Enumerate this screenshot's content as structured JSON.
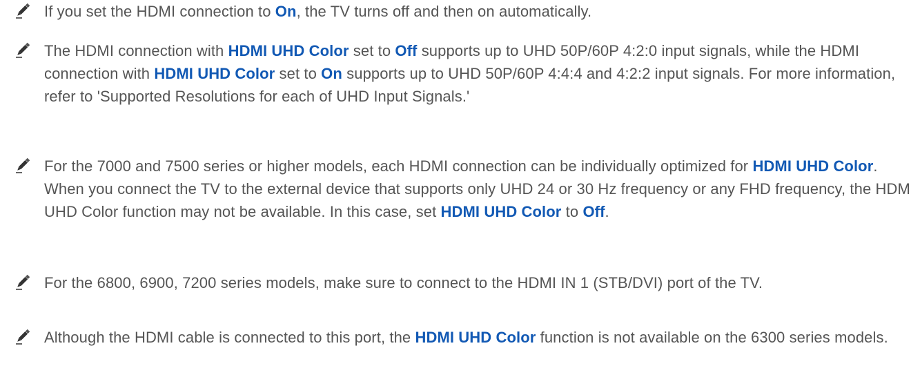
{
  "notes": [
    {
      "segments": [
        {
          "text": "If you set the HDMI connection to ",
          "highlight": false
        },
        {
          "text": "On",
          "highlight": true
        },
        {
          "text": ", the TV turns off and then on automatically.",
          "highlight": false
        }
      ]
    },
    {
      "segments": [
        {
          "text": "The HDMI connection with ",
          "highlight": false
        },
        {
          "text": "HDMI UHD Color",
          "highlight": true
        },
        {
          "text": " set to ",
          "highlight": false
        },
        {
          "text": "Off",
          "highlight": true
        },
        {
          "text": " supports up to UHD 50P/60P 4:2:0 input signals, while the HDMI connection with ",
          "highlight": false
        },
        {
          "text": "HDMI UHD Color",
          "highlight": true
        },
        {
          "text": " set to ",
          "highlight": false
        },
        {
          "text": "On",
          "highlight": true
        },
        {
          "text": " supports up to UHD 50P/60P 4:4:4 and 4:2:2 input signals. For more information, refer to 'Supported Resolutions for each of UHD Input Signals.'",
          "highlight": false
        }
      ]
    },
    {
      "segments": [
        {
          "text": "For the 7000 and 7500 series or higher models, each HDMI connection can be individually optimized for ",
          "highlight": false
        },
        {
          "text": "HDMI UHD Color",
          "highlight": true
        },
        {
          "text": ". When you connect the TV to the external device that supports only UHD 24 or 30 Hz frequency or any FHD frequency, the HDMI UHD Color function may not be available. In this case, set ",
          "highlight": false
        },
        {
          "text": "HDMI UHD Color",
          "highlight": true
        },
        {
          "text": " to ",
          "highlight": false
        },
        {
          "text": "Off",
          "highlight": true
        },
        {
          "text": ".",
          "highlight": false
        }
      ]
    },
    {
      "segments": [
        {
          "text": "For the 6800, 6900, 7200  series models, make sure to connect to the HDMI IN 1 (STB/DVI) port of the TV.",
          "highlight": false
        }
      ]
    },
    {
      "segments": [
        {
          "text": "Although the HDMI cable is connected to this port, the ",
          "highlight": false
        },
        {
          "text": "HDMI UHD Color",
          "highlight": true
        },
        {
          "text": " function is not available on the 6300 series models.",
          "highlight": false
        }
      ]
    }
  ],
  "icon": "pencil-icon",
  "colors": {
    "text": "#555555",
    "highlight": "#1259b4",
    "icon": "#333333"
  }
}
